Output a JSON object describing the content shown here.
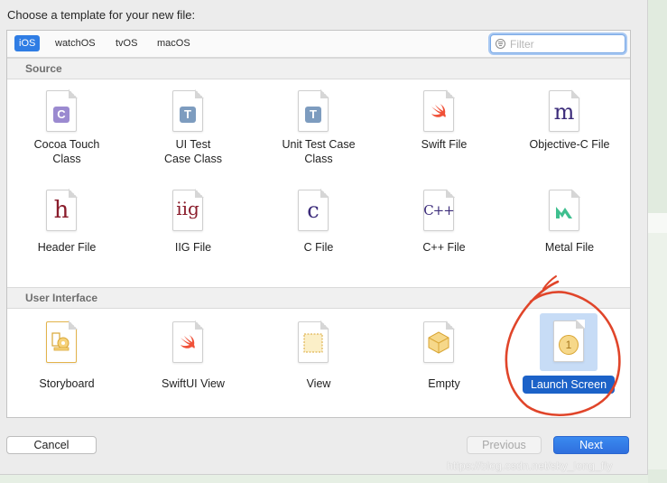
{
  "dialog": {
    "prompt": "Choose a template for your new file:"
  },
  "platforms": [
    {
      "label": "iOS",
      "active": true
    },
    {
      "label": "watchOS",
      "active": false
    },
    {
      "label": "tvOS",
      "active": false
    },
    {
      "label": "macOS",
      "active": false
    }
  ],
  "filter": {
    "placeholder": "Filter"
  },
  "sections": {
    "source": {
      "title": "Source",
      "items": [
        {
          "label": "Cocoa Touch Class",
          "icon": "cocoa-touch-class-icon",
          "glyph": "C"
        },
        {
          "label": "UI Test Case Class",
          "icon": "ui-test-case-class-icon",
          "glyph": "T"
        },
        {
          "label": "Unit Test Case Class",
          "icon": "unit-test-case-class-icon",
          "glyph": "T"
        },
        {
          "label": "Swift File",
          "icon": "swift-file-icon"
        },
        {
          "label": "Objective-C File",
          "icon": "objective-c-file-icon",
          "glyph": "m"
        },
        {
          "label": "Header File",
          "icon": "header-file-icon",
          "glyph": "h"
        },
        {
          "label": "IIG File",
          "icon": "iig-file-icon",
          "glyph": "iig"
        },
        {
          "label": "C File",
          "icon": "c-file-icon",
          "glyph": "c"
        },
        {
          "label": "C++ File",
          "icon": "cpp-file-icon",
          "glyph": "C++"
        },
        {
          "label": "Metal File",
          "icon": "metal-file-icon"
        }
      ]
    },
    "user_interface": {
      "title": "User Interface",
      "items": [
        {
          "label": "Storyboard",
          "icon": "storyboard-icon"
        },
        {
          "label": "SwiftUI View",
          "icon": "swiftui-view-icon"
        },
        {
          "label": "View",
          "icon": "view-icon"
        },
        {
          "label": "Empty",
          "icon": "empty-icon"
        },
        {
          "label": "Launch Screen",
          "icon": "launch-screen-icon",
          "glyph": "1",
          "selected": true
        }
      ]
    }
  },
  "buttons": {
    "cancel": "Cancel",
    "previous": "Previous",
    "next": "Next"
  },
  "watermark": "https://blog.csdn.net/sky_long_fly",
  "colors": {
    "accent": "#2f7de4",
    "selection": "#1c62c8",
    "annotation": "#e0452a",
    "swift": "#f05138",
    "objc": "#3b2b7a",
    "header": "#8a1c2b",
    "metal": "#3fbf8f"
  }
}
